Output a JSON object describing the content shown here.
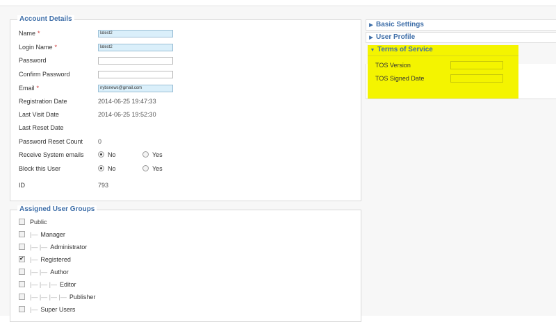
{
  "account": {
    "legend": "Account Details",
    "name_label": "Name",
    "name_required": "*",
    "name_value": "latest2",
    "login_label": "Login Name",
    "login_required": "*",
    "login_value": "latest2",
    "password_label": "Password",
    "confirm_label": "Confirm Password",
    "email_label": "Email",
    "email_required": "*",
    "email_value": "nybsnews@gmail.com",
    "reg_label": "Registration Date",
    "reg_value": "2014-06-25 19:47:33",
    "visit_label": "Last Visit Date",
    "visit_value": "2014-06-25 19:52:30",
    "reset_label": "Last Reset Date",
    "reset_count_label": "Password Reset Count",
    "reset_count_value": "0",
    "sys_label": "Receive System emails",
    "sys_selected": "No",
    "block_label": "Block this User",
    "block_selected": "No",
    "opt_no": "No",
    "opt_yes": "Yes",
    "id_label": "ID",
    "id_value": "793"
  },
  "groups": {
    "legend": "Assigned User Groups",
    "items": [
      {
        "tree": "",
        "label": "Public",
        "checked": false
      },
      {
        "tree": "|—",
        "label": "Manager",
        "checked": false
      },
      {
        "tree": "|— |—",
        "label": "Administrator",
        "checked": false
      },
      {
        "tree": "|—",
        "label": "Registered",
        "checked": true
      },
      {
        "tree": "|— |—",
        "label": "Author",
        "checked": false
      },
      {
        "tree": "|— |— |—",
        "label": "Editor",
        "checked": false
      },
      {
        "tree": "|— |— |— |—",
        "label": "Publisher",
        "checked": false
      },
      {
        "tree": "|—",
        "label": "Super Users",
        "checked": false
      }
    ]
  },
  "panels": {
    "basic": "Basic Settings",
    "profile": "User Profile",
    "tos": "Terms of Service",
    "tos_version_label": "TOS Version",
    "tos_signed_label": "TOS Signed Date"
  },
  "colors": {
    "accent": "#3e6ea8",
    "highlight": "#f4f400",
    "filled_input": "#daeffa"
  }
}
